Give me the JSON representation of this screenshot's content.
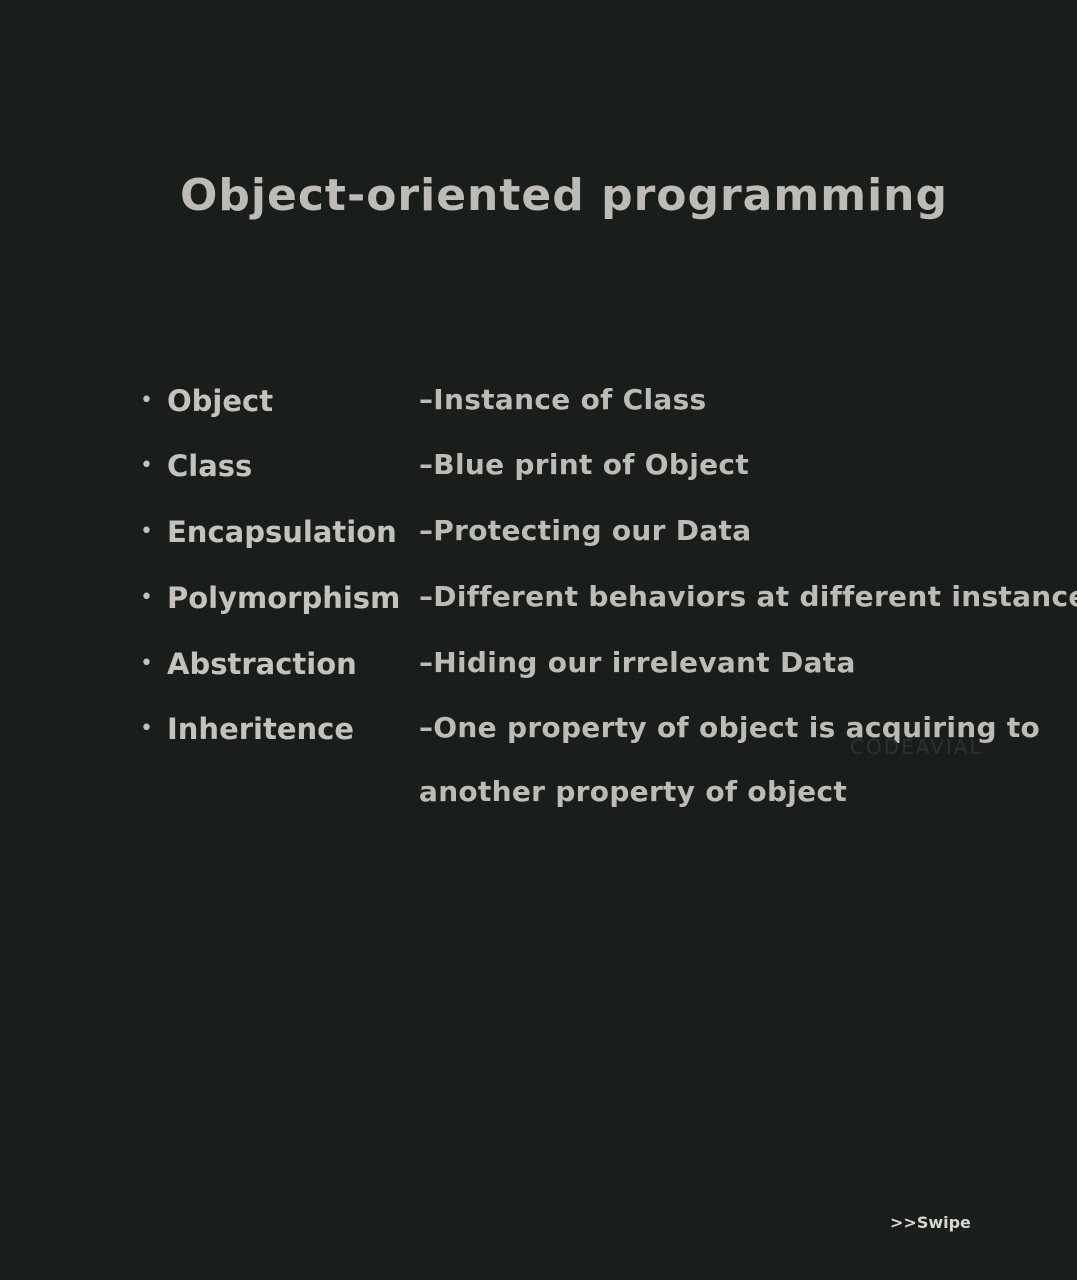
{
  "title": "Object-oriented programming",
  "items": [
    {
      "term": "Object",
      "description": "–Instance of Class"
    },
    {
      "term": "Class",
      "description": "–Blue print of Object"
    },
    {
      "term": "Encapsulation",
      "description": "–Protecting our Data"
    },
    {
      "term": "Polymorphism",
      "description": "–Different behaviors at different instances"
    },
    {
      "term": "Abstraction",
      "description": "–Hiding our irrelevant Data"
    },
    {
      "term": "Inheritence",
      "description": "–One property of object is acquiring to"
    }
  ],
  "continuation": "another property of object",
  "bullet": "•",
  "watermark": "CODEAVIAL",
  "swipe_label": ">>Swipe",
  "colors": {
    "background": "#1a1e1a",
    "text": "#c4c2bd"
  }
}
